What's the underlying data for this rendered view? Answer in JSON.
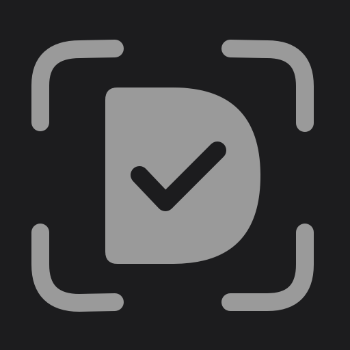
{
  "icon": {
    "name": "document-scan-check",
    "parts": [
      "scan-frame-corner",
      "document-d-shape",
      "checkmark-icon"
    ]
  },
  "colors": {
    "background": "#1c1c1e",
    "foreground": "#9a9a9a",
    "check": "#1c1c1e"
  }
}
